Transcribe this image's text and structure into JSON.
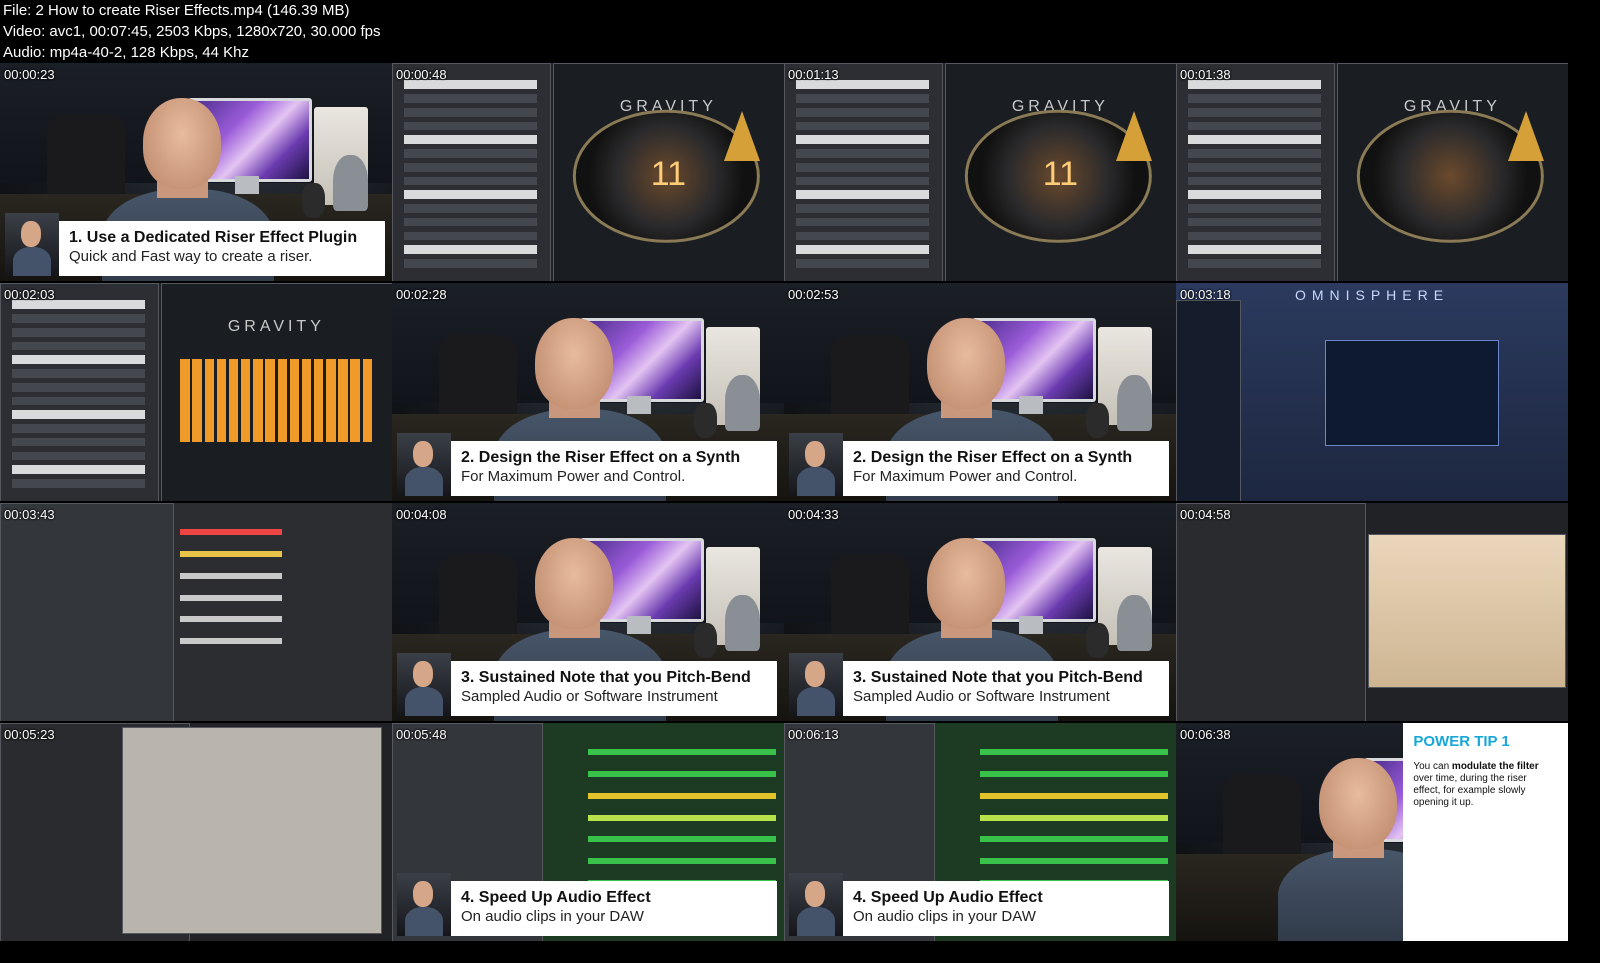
{
  "header": {
    "file_line": "File: 2 How to create Riser Effects.mp4 (146.39 MB)",
    "video_line": "Video: avc1, 00:07:45, 2503 Kbps, 1280x720, 30.000 fps",
    "audio_line": "Audio: mp4a-40-2, 128 Kbps, 44 Khz"
  },
  "tiles": [
    {
      "ts": "00:00:23",
      "scene": "presenter",
      "caption": {
        "line1": "1. Use a Dedicated Riser Effect Plugin",
        "line2": "Quick and Fast way to create a riser."
      }
    },
    {
      "ts": "00:00:48",
      "scene": "plugin-gravity",
      "label": "GRAVITY",
      "counter": "11"
    },
    {
      "ts": "00:01:13",
      "scene": "plugin-gravity",
      "label": "GRAVITY",
      "counter": "11"
    },
    {
      "ts": "00:01:38",
      "scene": "plugin-gravity",
      "label": "GRAVITY",
      "counter": ""
    },
    {
      "ts": "00:02:03",
      "scene": "plugin-gravity-bars",
      "label": "GRAVITY"
    },
    {
      "ts": "00:02:28",
      "scene": "presenter",
      "caption": {
        "line1": "2. Design the Riser Effect on a Synth",
        "line2": "For Maximum Power and Control."
      }
    },
    {
      "ts": "00:02:53",
      "scene": "presenter",
      "caption": {
        "line1": "2. Design the Riser Effect on a Synth",
        "line2": "For Maximum Power and Control."
      }
    },
    {
      "ts": "00:03:18",
      "scene": "synth-omnisphere",
      "label": "OMNISPHERE"
    },
    {
      "ts": "00:03:43",
      "scene": "daw"
    },
    {
      "ts": "00:04:08",
      "scene": "presenter",
      "caption": {
        "line1": "3. Sustained Note that you Pitch-Bend",
        "line2": "Sampled Audio or Software Instrument"
      }
    },
    {
      "ts": "00:04:33",
      "scene": "presenter",
      "caption": {
        "line1": "3. Sustained Note that you Pitch-Bend",
        "line2": "Sampled Audio or Software Instrument"
      }
    },
    {
      "ts": "00:04:58",
      "scene": "sampler"
    },
    {
      "ts": "00:05:23",
      "scene": "sampler-editor"
    },
    {
      "ts": "00:05:48",
      "scene": "daw-audio",
      "caption": {
        "line1": "4. Speed Up Audio Effect",
        "line2": "On audio clips in your DAW"
      }
    },
    {
      "ts": "00:06:13",
      "scene": "daw-audio",
      "caption": {
        "line1": "4. Speed Up Audio Effect",
        "line2": "On audio clips in your DAW"
      }
    },
    {
      "ts": "00:06:38",
      "scene": "presenter-tip",
      "tip": {
        "title": "POWER TIP 1",
        "pre": "You can ",
        "bold": "modulate the filter",
        "post": " over time, during the riser effect, for example slowly opening it up."
      }
    }
  ]
}
